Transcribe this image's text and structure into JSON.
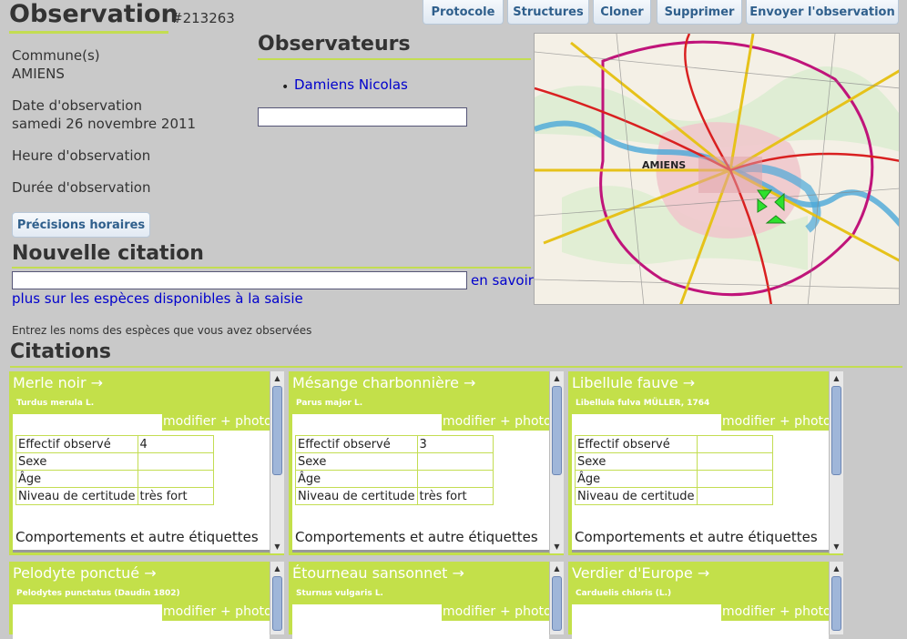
{
  "header": {
    "title": "Observation",
    "id": "#213263"
  },
  "buttons": {
    "protocole": "Protocole",
    "structures": "Structures",
    "cloner": "Cloner",
    "supprimer": "Supprimer",
    "envoyer": "Envoyer l'observation"
  },
  "info": {
    "commune_label": "Commune(s)",
    "commune_value": "AMIENS",
    "date_label": "Date d'observation",
    "date_value": "samedi 26 novembre 2011",
    "heure_label": "Heure d'observation",
    "duree_label": "Durée d'observation",
    "precisions_button": "Précisions horaires"
  },
  "observers": {
    "title": "Observateurs",
    "items": [
      "Damiens Nicolas"
    ],
    "input_value": ""
  },
  "nouvelle_citation": {
    "title": "Nouvelle citation",
    "input_value": "",
    "learn_more_1": "en savoir",
    "learn_more_2": "plus sur les espèces disponibles à la saisie",
    "help": "Entrez les noms des espèces que vous avez observées"
  },
  "map": {
    "city_label": "AMIENS"
  },
  "citations": {
    "title": "Citations",
    "modifier": "modifier",
    "photo": "+ photo",
    "comport": "Comportements et autre étiquettes",
    "labels": {
      "effectif": "Effectif observé",
      "sexe": "Sexe",
      "age": "Âge",
      "certitude": "Niveau de certitude"
    },
    "cards": [
      {
        "name": "Merle noir →",
        "sci": "Turdus merula L.",
        "effectif": "4",
        "sexe": "",
        "age": "",
        "certitude": "très fort"
      },
      {
        "name": "Mésange charbonnière →",
        "sci": "Parus major L.",
        "effectif": "3",
        "sexe": "",
        "age": "",
        "certitude": "très fort"
      },
      {
        "name": "Libellule fauve →",
        "sci": "Libellula fulva MÜLLER, 1764",
        "effectif": "",
        "sexe": "",
        "age": "",
        "certitude": ""
      },
      {
        "name": "Pelodyte ponctué →",
        "sci": "Pelodytes punctatus (Daudin 1802)"
      },
      {
        "name": "Étourneau sansonnet →",
        "sci": "Sturnus vulgaris L."
      },
      {
        "name": "Verdier d'Europe →",
        "sci": "Carduelis chloris (L.)"
      }
    ]
  }
}
